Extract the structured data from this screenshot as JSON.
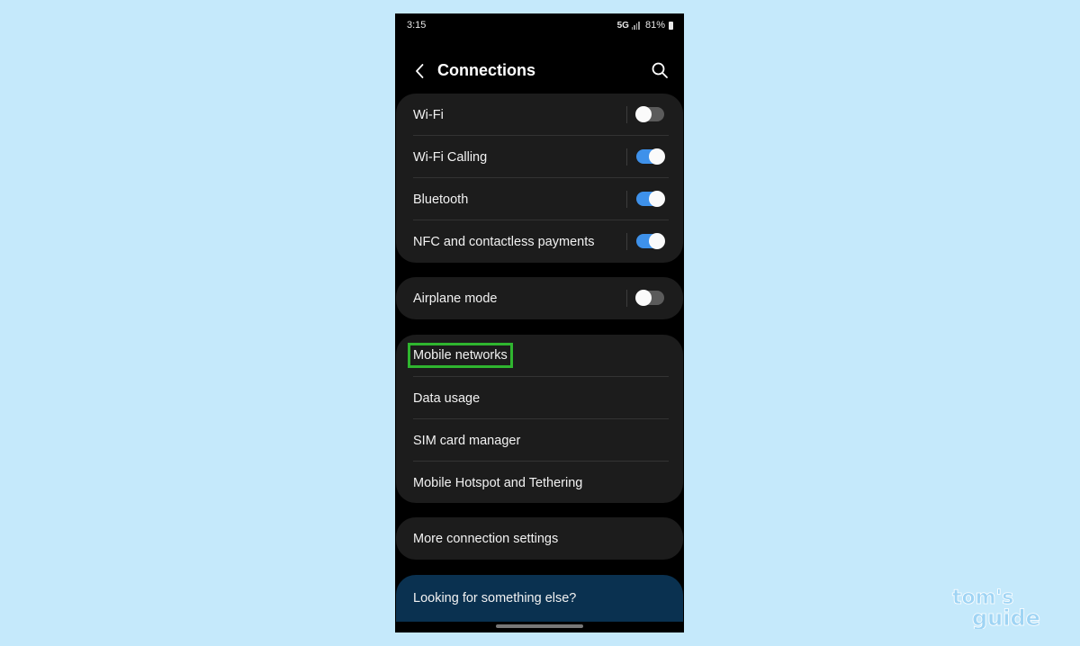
{
  "status": {
    "time": "3:15",
    "network": "5G",
    "battery": "81%"
  },
  "header": {
    "title": "Connections",
    "back_icon": "chevron-left-icon",
    "search_icon": "search-icon"
  },
  "group1": [
    {
      "label": "Wi-Fi",
      "toggle": false
    },
    {
      "label": "Wi-Fi Calling",
      "toggle": true
    },
    {
      "label": "Bluetooth",
      "toggle": true
    },
    {
      "label": "NFC and contactless payments",
      "toggle": true
    }
  ],
  "group2": [
    {
      "label": "Airplane mode",
      "toggle": false
    }
  ],
  "group3": [
    {
      "label": "Mobile networks",
      "highlighted": true
    },
    {
      "label": "Data usage"
    },
    {
      "label": "SIM card manager"
    },
    {
      "label": "Mobile Hotspot and Tethering"
    }
  ],
  "group4": [
    {
      "label": "More connection settings"
    }
  ],
  "help": {
    "label": "Looking for something else?"
  },
  "watermark": {
    "line1": "tom's",
    "line2": "guide"
  },
  "colors": {
    "background": "#c5e9fb",
    "toggle_on": "#3e91ea",
    "highlight": "#2fb52f",
    "help_card": "#0a3150"
  }
}
